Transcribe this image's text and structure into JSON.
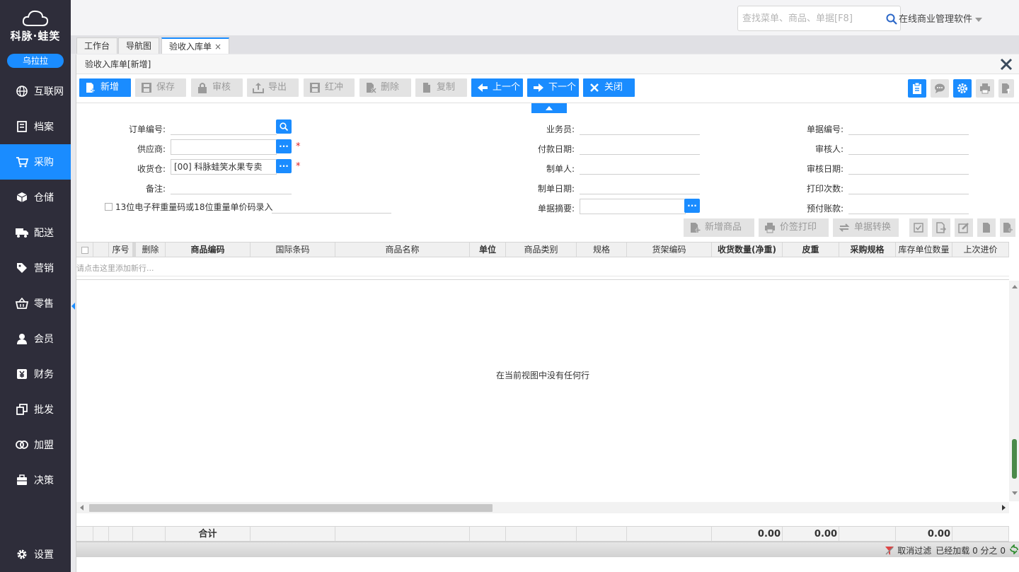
{
  "brand": {
    "name": "科脉·蛙笑",
    "user": "乌拉拉"
  },
  "sidebar": {
    "items": [
      {
        "label": "互联网",
        "icon": "globe-icon"
      },
      {
        "label": "档案",
        "icon": "document-icon"
      },
      {
        "label": "采购",
        "icon": "cart-icon",
        "active": true
      },
      {
        "label": "仓储",
        "icon": "box-icon"
      },
      {
        "label": "配送",
        "icon": "truck-icon"
      },
      {
        "label": "营销",
        "icon": "tag-icon"
      },
      {
        "label": "零售",
        "icon": "basket-icon"
      },
      {
        "label": "会员",
        "icon": "person-icon"
      },
      {
        "label": "财务",
        "icon": "yen-icon"
      },
      {
        "label": "批发",
        "icon": "copy-icon"
      },
      {
        "label": "加盟",
        "icon": "link-icon"
      },
      {
        "label": "决策",
        "icon": "briefcase-icon"
      }
    ],
    "settings": "设置"
  },
  "header": {
    "search_placeholder": "查找菜单、商品、单据[F8]",
    "app_name": "在线商业管理软件"
  },
  "tabs": [
    {
      "label": "工作台"
    },
    {
      "label": "导航图"
    },
    {
      "label": "验收入库单",
      "active": true,
      "close": "×"
    }
  ],
  "panel": {
    "title": "验收入库单[新增]"
  },
  "toolbar": {
    "new": "新增",
    "save": "保存",
    "audit": "审核",
    "export": "导出",
    "reverse": "红冲",
    "delete": "删除",
    "copy": "复制",
    "prev": "上一个",
    "next": "下一个",
    "close": "关闭"
  },
  "form": {
    "order_no_label": "订单编号:",
    "supplier_label": "供应商:",
    "warehouse_label": "收货仓:",
    "warehouse_value": "[00] 科脉蛙笑水果专卖",
    "remark_label": "备注:",
    "scale_checkbox_label": "13位电子秤重量码或18位重量单价码录入",
    "salesman_label": "业务员:",
    "pay_date_label": "付款日期:",
    "creator_label": "制单人:",
    "create_date_label": "制单日期:",
    "summary_label": "单据摘要:",
    "doc_no_label": "单据编号:",
    "auditor_label": "审核人:",
    "audit_date_label": "审核日期:",
    "print_count_label": "打印次数:",
    "prepaid_label": "预付账款:",
    "required_mark": "*",
    "lookup_dots": "···"
  },
  "grid_toolbar": {
    "add_product": "新增商品",
    "price_print": "价签打印",
    "doc_convert": "单据转换"
  },
  "grid": {
    "columns": [
      "序号",
      "删除",
      "商品编码",
      "国际条码",
      "商品名称",
      "单位",
      "商品类别",
      "规格",
      "货架编码",
      "收货数量(净重)",
      "皮重",
      "采购规格",
      "库存单位数量",
      "上次进价"
    ],
    "new_row_hint": "请点击这里添加新行...",
    "empty_message": "在当前视图中没有任何行",
    "summary_label": "合计",
    "sum_qty": "0.00",
    "sum_tare": "0.00",
    "sum_stock": "0.00"
  },
  "status": {
    "cancel_filter": "取消过滤",
    "loaded": "已经加载 0 分之 0"
  },
  "colors": {
    "accent": "#1a8cff",
    "sidebar_bg": "#2e2d3a",
    "required": "#e02020"
  }
}
